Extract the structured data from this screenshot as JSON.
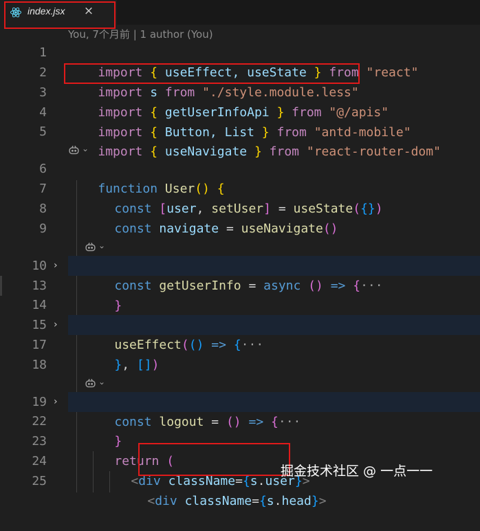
{
  "tab": {
    "filename": "index.jsx",
    "close_glyph": "×",
    "icon": "react-icon",
    "icon_color": "#61dafb"
  },
  "codelens": {
    "blame": "You, 7个月前 | 1 author (You)"
  },
  "lens_icons": [
    "copilot-icon",
    "chevron-down-icon"
  ],
  "line_numbers": [
    "1",
    "2",
    "3",
    "4",
    "5",
    "6",
    "7",
    "8",
    "9",
    "10",
    "13",
    "14",
    "15",
    "17",
    "18",
    "19",
    "22",
    "23",
    "24",
    "25"
  ],
  "fold_glyph": "›",
  "code": {
    "l1": [
      "import",
      "{",
      " useEffect, useState ",
      "}",
      "from",
      "\"react\""
    ],
    "l2": [
      "import",
      "s",
      "from",
      "\"./style.module.less\""
    ],
    "l3": [
      "import",
      "{",
      " getUserInfoApi ",
      "}",
      "from",
      "\"@/apis\""
    ],
    "l4": [
      "import",
      "{",
      " Button, List ",
      "}",
      "from",
      "\"antd-mobile\""
    ],
    "l5": [
      "import",
      "{",
      " useNavigate ",
      "}",
      "from",
      "\"react-router-dom\""
    ],
    "l6": [
      "function",
      "User",
      "(",
      ")",
      "{"
    ],
    "l7": [
      "const",
      "[",
      "user",
      ",",
      "setUser",
      "]",
      "=",
      "useState",
      "(",
      "{}",
      ")"
    ],
    "l8": [
      "const",
      "navigate",
      "=",
      "useNavigate",
      "()"
    ],
    "l10": [
      "const",
      "getUserInfo",
      "=",
      "async",
      "()",
      "=>",
      "{",
      "···"
    ],
    "l13": [
      "}"
    ],
    "l15": [
      "useEffect",
      "(",
      "()",
      "=>",
      "{",
      "···"
    ],
    "l17": [
      "}",
      ",",
      "[]",
      ")"
    ],
    "l19": [
      "const",
      "logout",
      "=",
      "()",
      "=>",
      "{",
      "···"
    ],
    "l22": [
      "}"
    ],
    "l23": [
      "return",
      "("
    ],
    "l24": [
      "<",
      "div",
      "className",
      "=",
      "{",
      "s",
      ".",
      "user",
      "}",
      ">"
    ],
    "l25": [
      "<",
      "div",
      "className",
      "=",
      "{",
      "s",
      ".",
      "head",
      "}",
      ">"
    ]
  },
  "watermark": "掘金技术社区 @ 一点一一",
  "colors": {
    "background": "#1f1f1f",
    "keyword_purple": "#c586c0",
    "keyword_blue": "#569cd6",
    "string": "#ce9178",
    "variable": "#9cdcfe",
    "function": "#dcdcaa",
    "bracket_gold": "#ffd700",
    "bracket_pink": "#da70d6",
    "bracket_blue": "#179fff",
    "annotation_red": "#e01a1a"
  }
}
